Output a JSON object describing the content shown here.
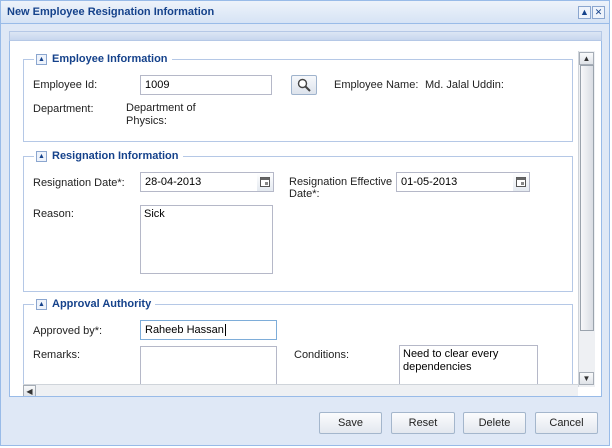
{
  "window": {
    "title": "New Employee Resignation Information",
    "collapse_icon": "caret-up-icon",
    "close_icon": "close-icon"
  },
  "employee_info": {
    "legend": "Employee Information",
    "employee_id_label": "Employee Id:",
    "employee_id_value": "1009",
    "search_icon": "magnifier-icon",
    "employee_name_label": "Employee Name:",
    "employee_name_value": "Md. Jalal Uddin:",
    "department_label": "Department:",
    "department_value": "Department of\nPhysics:"
  },
  "resignation_info": {
    "legend": "Resignation Information",
    "resignation_date_label": "Resignation Date*:",
    "resignation_date_value": "28-04-2013",
    "effective_date_label": "Resignation Effective\nDate*:",
    "effective_date_value": "01-05-2013",
    "reason_label": "Reason:",
    "reason_value": "Sick",
    "calendar_icon": "calendar-icon"
  },
  "approval_authority": {
    "legend": "Approval Authority",
    "approved_by_label": "Approved by*:",
    "approved_by_value": "Raheeb Hassan",
    "remarks_label": "Remarks:",
    "remarks_value": "",
    "conditions_label": "Conditions:",
    "conditions_value": "Need to clear every\ndependencies"
  },
  "buttons": {
    "save": "Save",
    "reset": "Reset",
    "delete": "Delete",
    "cancel": "Cancel"
  },
  "colors": {
    "title_text": "#15428b",
    "frame_border": "#99bbe8",
    "frame_bg": "#dfe8f6"
  }
}
